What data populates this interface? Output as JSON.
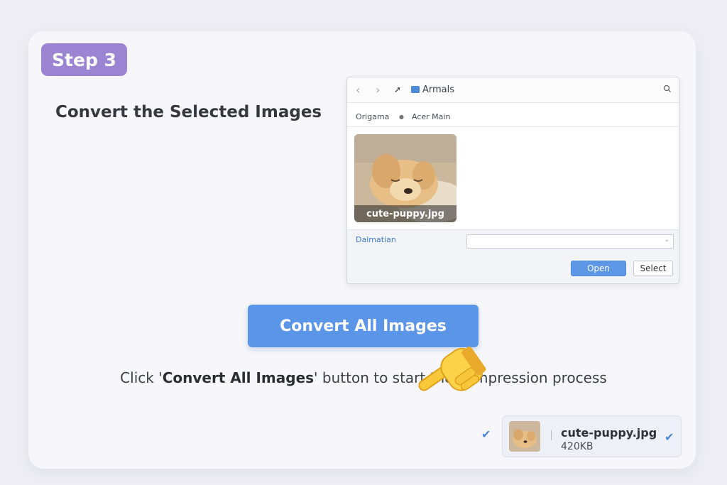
{
  "step": {
    "label": "Step 3"
  },
  "title": "Convert the Selected Images",
  "dialog": {
    "nav_back": "‹",
    "nav_forward": "›",
    "path": "Armals",
    "places": [
      "Origama",
      "Acer Main"
    ],
    "file": {
      "name": "cute-puppy.jpg"
    },
    "field_label": "Dalmatian",
    "field_value": "",
    "open_label": "Open",
    "select_label": "Select"
  },
  "convert_button": {
    "label": "Convert All Images"
  },
  "hint": {
    "before": "Click '",
    "bold": "Convert All Images",
    "after": "' button to start the compression process"
  },
  "file_chip": {
    "name": "cute-puppy.jpg",
    "size": "420KB"
  },
  "colors": {
    "accent": "#5b95e8",
    "step_badge": "#9b85d2",
    "link": "#3d7ccf"
  },
  "icons": [
    "back-arrow-icon",
    "forward-arrow-icon",
    "pin-icon",
    "folder-icon",
    "search-icon",
    "pointing-hand-icon",
    "check-icon",
    "chevron-down-icon"
  ]
}
